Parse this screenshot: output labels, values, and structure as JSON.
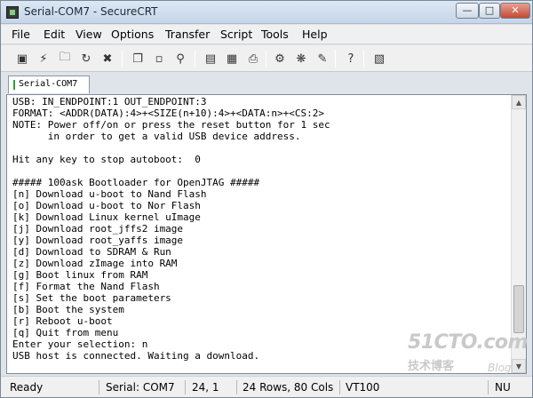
{
  "window": {
    "title": "Serial-COM7 - SecureCRT"
  },
  "menu": [
    "File",
    "Edit",
    "View",
    "Options",
    "Transfer",
    "Script",
    "Tools",
    "Help"
  ],
  "toolbar": {
    "icons": [
      "connect-icon",
      "quick-connect-icon",
      "connect-tab-icon",
      "reconnect-icon",
      "disconnect-icon",
      "copy-icon",
      "paste-icon",
      "find-icon",
      "print-screen-icon",
      "print-selection-icon",
      "print-icon",
      "session-options-icon",
      "global-options-icon",
      "keymap-icon",
      "help-icon",
      "log-icon"
    ]
  },
  "tab": {
    "label": "Serial-COM7"
  },
  "terminal": {
    "lines": [
      "USB: IN_ENDPOINT:1 OUT_ENDPOINT:3",
      "FORMAT: <ADDR(DATA):4>+<SIZE(n+10):4>+<DATA:n>+<CS:2>",
      "NOTE: Power off/on or press the reset button for 1 sec",
      "      in order to get a valid USB device address.",
      "",
      "Hit any key to stop autoboot:  0",
      "",
      "##### 100ask Bootloader for OpenJTAG #####",
      "[n] Download u-boot to Nand Flash",
      "[o] Download u-boot to Nor Flash",
      "[k] Download Linux kernel uImage",
      "[j] Download root_jffs2 image",
      "[y] Download root_yaffs image",
      "[d] Download to SDRAM & Run",
      "[z] Download zImage into RAM",
      "[g] Boot linux from RAM",
      "[f] Format the Nand Flash",
      "[s] Set the boot parameters",
      "[b] Boot the system",
      "[r] Reboot u-boot",
      "[q] Quit from menu",
      "Enter your selection: n",
      "USB host is connected. Waiting a download."
    ],
    "scroll_position": 0.88
  },
  "watermark": {
    "site": "51CTO.com",
    "tagline": "技术博客",
    "blog": "Blog"
  },
  "status": {
    "ready": "Ready",
    "port": "Serial: COM7",
    "cursor": "24,   1",
    "size": "24 Rows,  80 Cols",
    "emulation": "VT100",
    "keys": "NU"
  }
}
